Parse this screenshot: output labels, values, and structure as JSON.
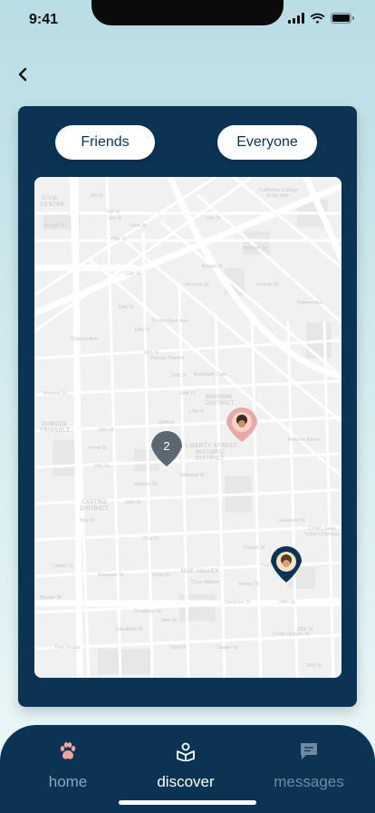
{
  "status_bar": {
    "time": "9:41"
  },
  "toggle": {
    "friends_label": "Friends",
    "everyone_label": "Everyone"
  },
  "map": {
    "cluster_count": "2",
    "district_labels": [
      "MISSION",
      "DISTRICT",
      "LIBERTY STREET",
      "HISTORIC",
      "DISTRICT",
      "CASTRO",
      "DISTRICT",
      "NOE VALLEY",
      "DUBOCE",
      "TRIANGLE",
      "CIVIC",
      "CENTER"
    ],
    "place_labels": [
      "California College",
      "of the Arts",
      "Victoria Theatre",
      "Balompie Cafe",
      "Delfina",
      "Bracero Bistro",
      "Chez Marius",
      "CPMC Saint",
      "Luke's Campus",
      "Twin Peaks",
      "Market St",
      "Mission St",
      "Valencia St",
      "Guerrero St",
      "Dolores St",
      "Church St",
      "Sanchez St",
      "Noe St",
      "Castro St",
      "S Van Ness Ave",
      "Potrero Ave",
      "Bryant St",
      "Harrison St",
      "Folsom St",
      "Division St",
      "Duboce Ave",
      "Cesar Chavez St",
      "18th St",
      "19th St",
      "20th St",
      "21st St",
      "22nd St",
      "23rd St",
      "24th St",
      "25th St",
      "26th St",
      "Hill St",
      "Dore St",
      "Otis St",
      "Mission St",
      "Gough St",
      "Pond St",
      "Noe St",
      "Alvarado St",
      "Elizabeth St",
      "Clipper St",
      "Douglass St",
      "Jersey St",
      "8th St",
      "9th St",
      "10th St",
      "11th St",
      "12th St",
      "13th St",
      "14th St",
      "15th St",
      "16th St",
      "17th St"
    ]
  },
  "nav": {
    "home_label": "home",
    "discover_label": "discover",
    "messages_label": "messages"
  },
  "colors": {
    "navy": "#0b3454",
    "pin_pink": "#e8a9a9",
    "pin_gray": "#5b6772",
    "inactive": "#6f8aa0"
  }
}
